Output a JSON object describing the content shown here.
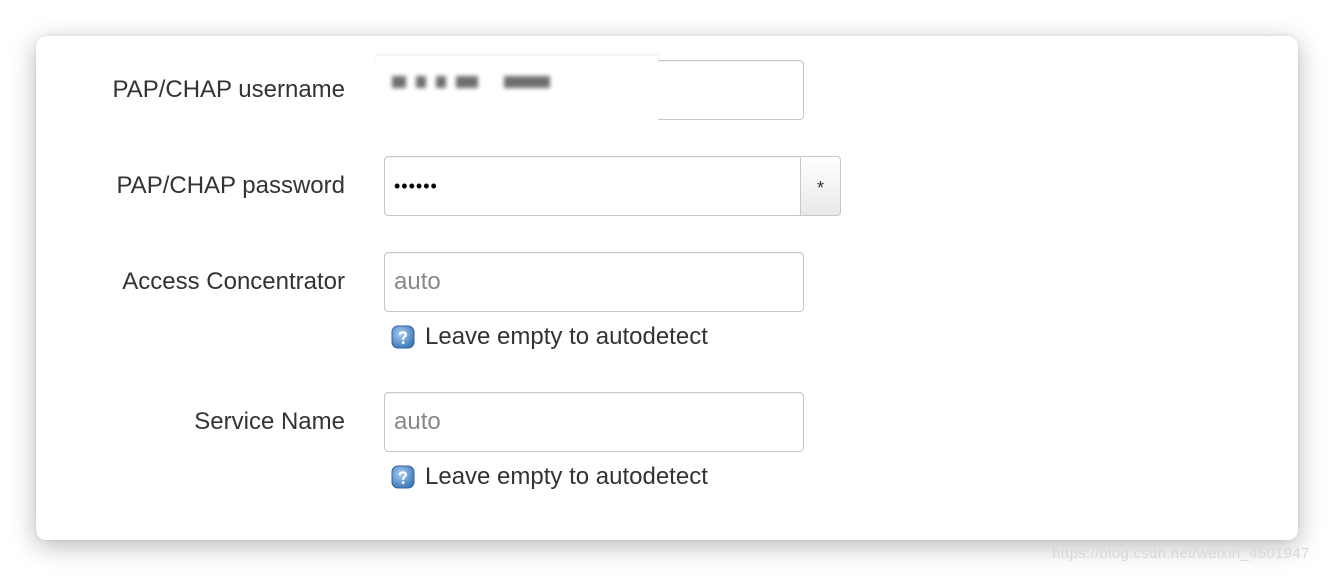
{
  "form": {
    "username": {
      "label": "PAP/CHAP username",
      "value": ""
    },
    "password": {
      "label": "PAP/CHAP password",
      "value": "••••••",
      "reveal_label": "*"
    },
    "access_concentrator": {
      "label": "Access Concentrator",
      "placeholder": "auto",
      "hint": "Leave empty to autodetect"
    },
    "service_name": {
      "label": "Service Name",
      "placeholder": "auto",
      "hint": "Leave empty to autodetect"
    }
  },
  "icons": {
    "help": "question-icon"
  },
  "colors": {
    "help_icon": "#5b8fc7",
    "border": "#c8c8c8",
    "text": "#333333",
    "placeholder": "#888888"
  },
  "watermark": "https://blog.csdn.net/weixin_4501947"
}
